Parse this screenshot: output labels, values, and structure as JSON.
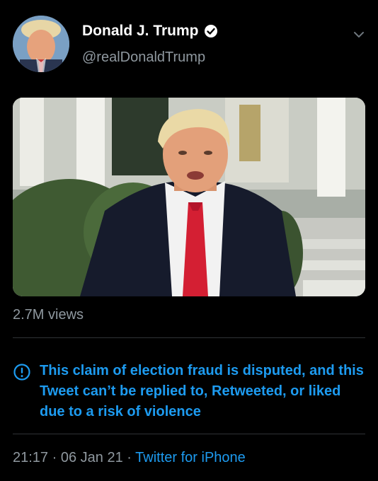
{
  "author": {
    "display_name": "Donald J. Trump",
    "handle": "@realDonaldTrump",
    "verified": true
  },
  "media": {
    "views": "2.7M views"
  },
  "notice": {
    "text": "This claim of election fraud is disputed, and this Tweet can’t be replied to, Retweeted, or liked due to a risk of violence"
  },
  "meta": {
    "time": "21:17",
    "separator": "·",
    "date": "06 Jan 21",
    "source": "Twitter for iPhone"
  },
  "icons": {
    "verified": "verified-badge-icon",
    "more": "chevron-down-icon",
    "notice": "info-exclamation-icon"
  },
  "colors": {
    "background": "#000000",
    "link": "#1d9bf0",
    "secondary_text": "#8f989f",
    "divider": "#2f3336"
  }
}
